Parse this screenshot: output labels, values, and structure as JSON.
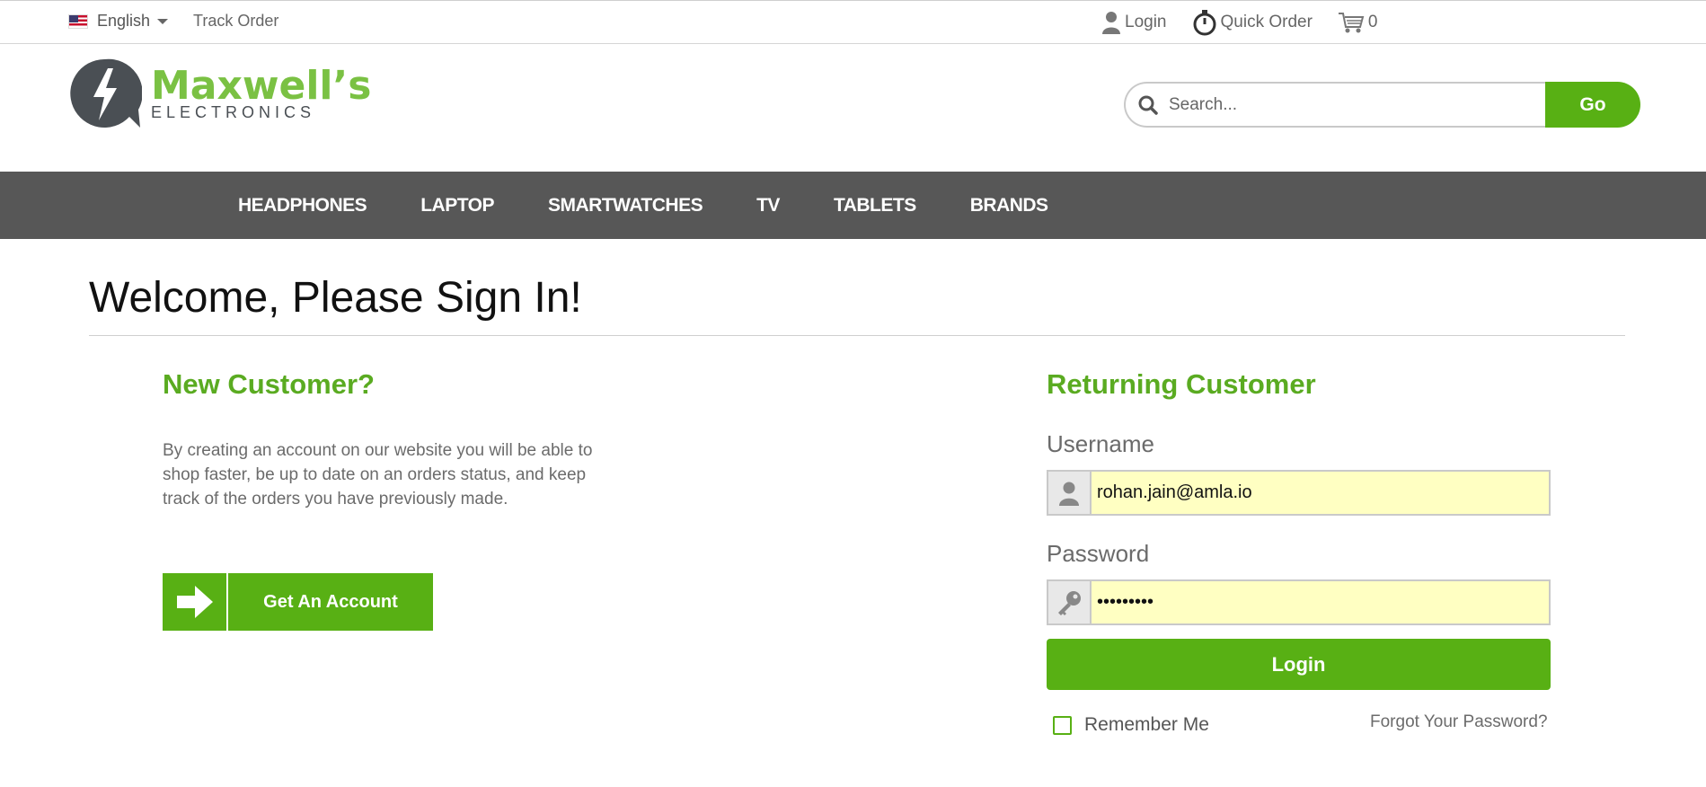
{
  "topbar": {
    "language": "English",
    "track_order": "Track Order",
    "login": "Login",
    "quick_order": "Quick Order",
    "cart_count": "0"
  },
  "brand": {
    "name": "Maxwell’s",
    "subtitle": "ELECTRONICS",
    "color": "#7ac143",
    "dark": "#4a4f54"
  },
  "search": {
    "placeholder": "Search...",
    "button": "Go"
  },
  "nav": {
    "items": [
      "HEADPHONES",
      "LAPTOP",
      "SMARTWATCHES",
      "TV",
      "TABLETS",
      "BRANDS"
    ]
  },
  "main": {
    "title": "Welcome, Please Sign In!",
    "new_customer": {
      "heading": "New Customer?",
      "text": "By creating an account on our website you will be able to shop faster, be up to date on an orders status, and keep track of the orders you have previously made.",
      "button": "Get An Account"
    },
    "returning": {
      "heading": "Returning Customer",
      "username_label": "Username",
      "username_value": "rohan.jain@amla.io",
      "password_label": "Password",
      "password_value": "•••••••••",
      "login_button": "Login",
      "remember_me": "Remember Me",
      "forgot": "Forgot Your Password?"
    }
  },
  "colors": {
    "accent": "#58b014",
    "nav_bg": "#575757",
    "field_bg": "#ffffc2"
  }
}
